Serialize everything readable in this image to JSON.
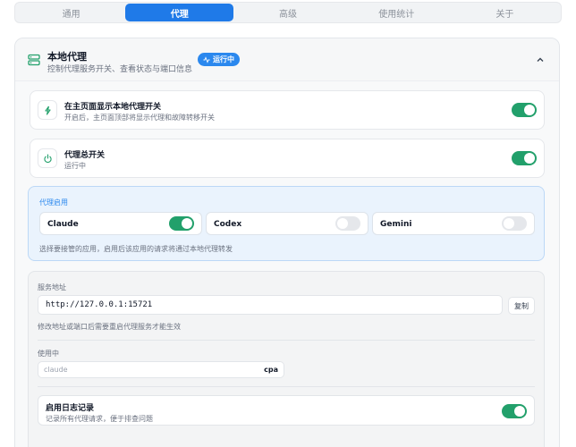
{
  "tabs": [
    {
      "label": "通用",
      "active": false
    },
    {
      "label": "代理",
      "active": true
    },
    {
      "label": "高级",
      "active": false
    },
    {
      "label": "使用统计",
      "active": false
    },
    {
      "label": "关于",
      "active": false
    }
  ],
  "local_proxy": {
    "title": "本地代理",
    "subtitle": "控制代理服务开关、查看状态与端口信息",
    "status_badge": "运行中",
    "icon": "server-icon",
    "collapse_icon": "chevron-up-icon"
  },
  "show_toggle": {
    "title": "在主页面显示本地代理开关",
    "subtitle": "开启后，主页面顶部将显示代理和故障转移开关",
    "icon": "lightning-icon",
    "on": true
  },
  "master_switch": {
    "title": "代理总开关",
    "subtitle": "运行中",
    "icon": "power-icon",
    "on": true
  },
  "proxy_apps": {
    "title": "代理启用",
    "note": "选择要接管的应用，启用后该应用的请求将通过本地代理转发",
    "apps": [
      {
        "name": "Claude",
        "on": true
      },
      {
        "name": "Codex",
        "on": false
      },
      {
        "name": "Gemini",
        "on": false
      }
    ]
  },
  "service": {
    "address_label": "服务地址",
    "address_value": "http://127.0.0.1:15721",
    "copy_label": "复制",
    "address_note": "修改地址或端口后需要重启代理服务才能生效",
    "in_use_label": "使用中",
    "in_use_placeholder": "claude",
    "in_use_tag": "cpa",
    "log_title": "启用日志记录",
    "log_subtitle": "记录所有代理请求，便于排查问题",
    "log_on": true
  },
  "colors": {
    "accent": "#1f7ae8",
    "toggle_on": "#22a06b",
    "badge": "#2b88ee"
  }
}
